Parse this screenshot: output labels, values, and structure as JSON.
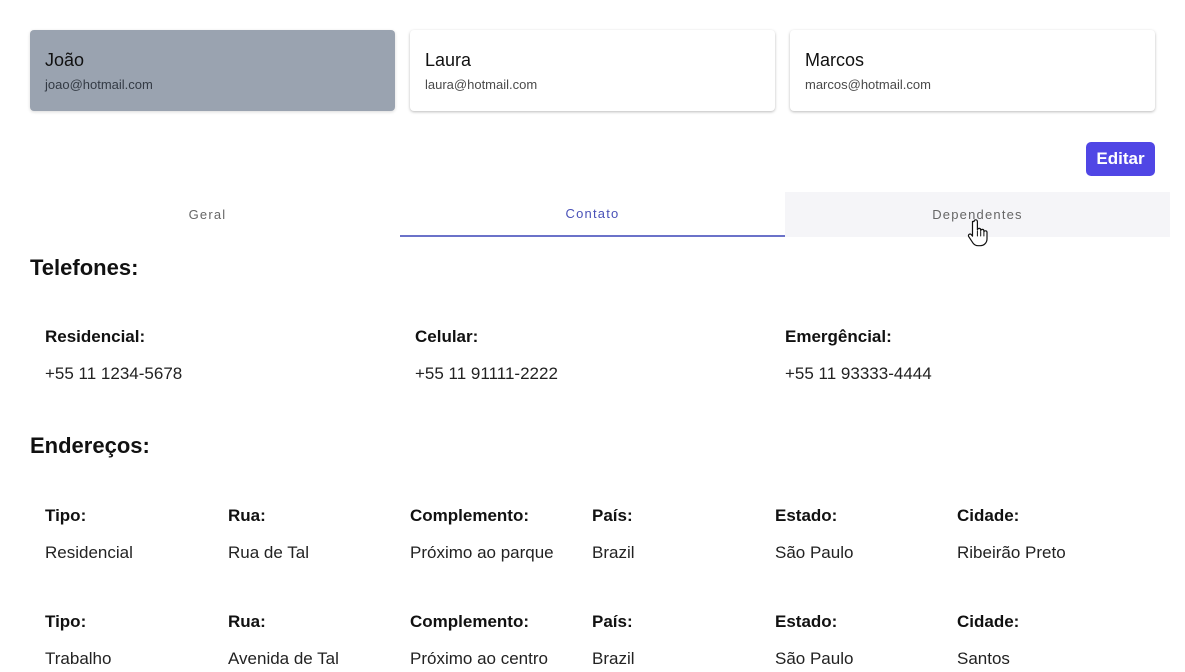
{
  "users": [
    {
      "name": "João",
      "email": "joao@hotmail.com",
      "selected": true
    },
    {
      "name": "Laura",
      "email": "laura@hotmail.com",
      "selected": false
    },
    {
      "name": "Marcos",
      "email": "marcos@hotmail.com",
      "selected": false
    }
  ],
  "actions": {
    "edit_label": "Editar"
  },
  "tabs": [
    {
      "label": "Geral",
      "active": false
    },
    {
      "label": "Contato",
      "active": true
    },
    {
      "label": "Dependentes",
      "active": false
    }
  ],
  "phones": {
    "title": "Telefones:",
    "items": [
      {
        "label": "Residencial:",
        "value": "+55 11 1234-5678"
      },
      {
        "label": "Celular:",
        "value": "+55 11 91111-2222"
      },
      {
        "label": "Emergêncial:",
        "value": "+55 11 93333-4444"
      }
    ]
  },
  "addresses": {
    "title": "Endereços:",
    "labels": {
      "tipo": "Tipo:",
      "rua": "Rua:",
      "complemento": "Complemento:",
      "pais": "País:",
      "estado": "Estado:",
      "cidade": "Cidade:"
    },
    "rows": [
      {
        "tipo": "Residencial",
        "rua": "Rua de Tal",
        "complemento": "Próximo ao parque",
        "pais": "Brazil",
        "estado": "São Paulo",
        "cidade": "Ribeirão Preto"
      },
      {
        "tipo": "Trabalho",
        "rua": "Avenida de Tal",
        "complemento": "Próximo ao centro",
        "pais": "Brazil",
        "estado": "São Paulo",
        "cidade": "Santos"
      }
    ]
  },
  "colors": {
    "selected_card": "#9aa3b0",
    "primary_button": "#5046e5",
    "active_tab": "#4a52b8"
  },
  "icons": {
    "cursor": "hand-pointer-icon"
  }
}
